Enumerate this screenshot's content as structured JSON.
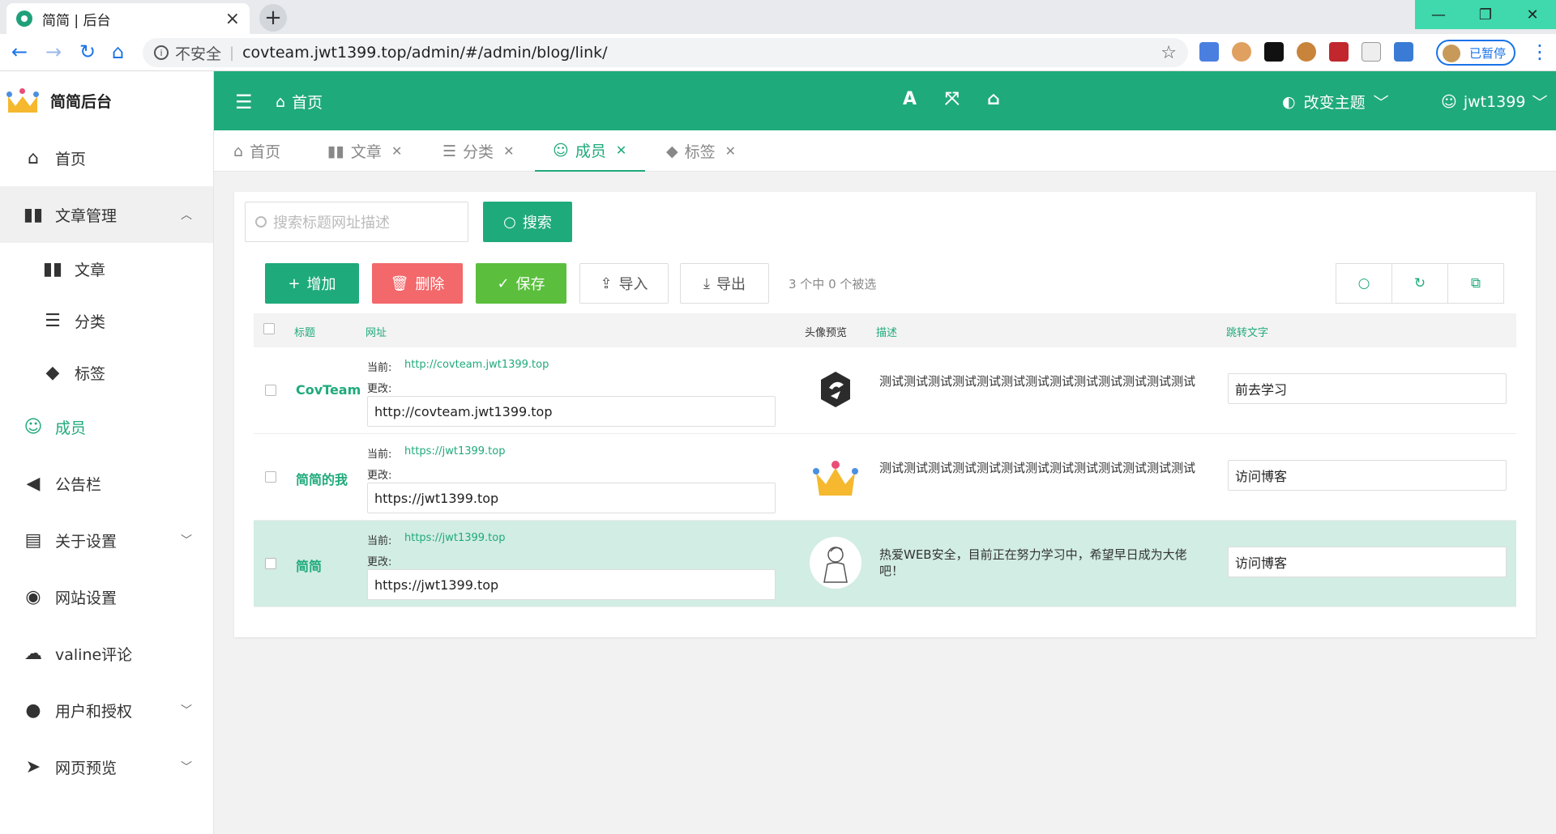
{
  "browser": {
    "tab_title": "简简 | 后台",
    "tab_close": "×",
    "new_tab": "+",
    "security_label": "不安全",
    "url": "covteam.jwt1399.top/admin/#/admin/blog/link/",
    "paused_label": "已暂停"
  },
  "sidebar": {
    "logo_text": "简简后台",
    "items": [
      {
        "label": "首页",
        "icon": "home-icon"
      },
      {
        "label": "文章管理",
        "icon": "book-icon",
        "arrow": "︿"
      },
      {
        "label": "文章",
        "icon": "book-icon"
      },
      {
        "label": "分类",
        "icon": "list-icon"
      },
      {
        "label": "标签",
        "icon": "tags-icon"
      },
      {
        "label": "成员",
        "icon": "user-icon"
      },
      {
        "label": "公告栏",
        "icon": "megaphone-icon"
      },
      {
        "label": "关于设置",
        "icon": "id-card-icon",
        "arrow": "﹀"
      },
      {
        "label": "网站设置",
        "icon": "globe-icon"
      },
      {
        "label": "valine评论",
        "icon": "comments-icon"
      },
      {
        "label": "用户和授权",
        "icon": "user-shield-icon",
        "arrow": "﹀"
      },
      {
        "label": "网页预览",
        "icon": "paper-plane-icon",
        "arrow": "﹀"
      }
    ]
  },
  "header": {
    "home_label": "首页",
    "font_btn": "A",
    "theme_label": "改变主题",
    "username": "jwt1399"
  },
  "tabs": [
    {
      "label": "首页",
      "icon": "home-icon",
      "closable": false
    },
    {
      "label": "文章",
      "icon": "book-icon",
      "closable": true
    },
    {
      "label": "分类",
      "icon": "list-icon",
      "closable": true
    },
    {
      "label": "成员",
      "icon": "user-icon",
      "closable": true
    },
    {
      "label": "标签",
      "icon": "tags-icon",
      "closable": true
    }
  ],
  "toolbar": {
    "search_placeholder": "搜索标题网址描述",
    "search_btn": "搜索",
    "add_btn": "增加",
    "delete_btn": "删除",
    "save_btn": "保存",
    "import_btn": "导入",
    "export_btn": "导出",
    "selection_info": "3 个中 0 个被选"
  },
  "table": {
    "columns": [
      "标题",
      "网址",
      "头像预览",
      "描述",
      "跳转文字"
    ],
    "current_label": "当前:",
    "change_label": "更改:",
    "rows": [
      {
        "title": "CovTeam",
        "current_url": "http://covteam.jwt1399.top",
        "url_value": "http://covteam.jwt1399.top",
        "avatar": "dark-logo",
        "desc": "测试测试测试测试测试测试测试测试测试测试测试测试测试",
        "jump_text": "前去学习"
      },
      {
        "title": "简简的我",
        "current_url": "https://jwt1399.top",
        "url_value": "https://jwt1399.top",
        "avatar": "crown-logo",
        "desc": "测试测试测试测试测试测试测试测试测试测试测试测试测试",
        "jump_text": "访问博客"
      },
      {
        "title": "简简",
        "current_url": "https://jwt1399.top",
        "url_value": "https://jwt1399.top",
        "avatar": "sketch-portrait",
        "desc": "热爱WEB安全，目前正在努力学习中，希望早日成为大佬吧！",
        "jump_text": "访问博客"
      }
    ]
  }
}
